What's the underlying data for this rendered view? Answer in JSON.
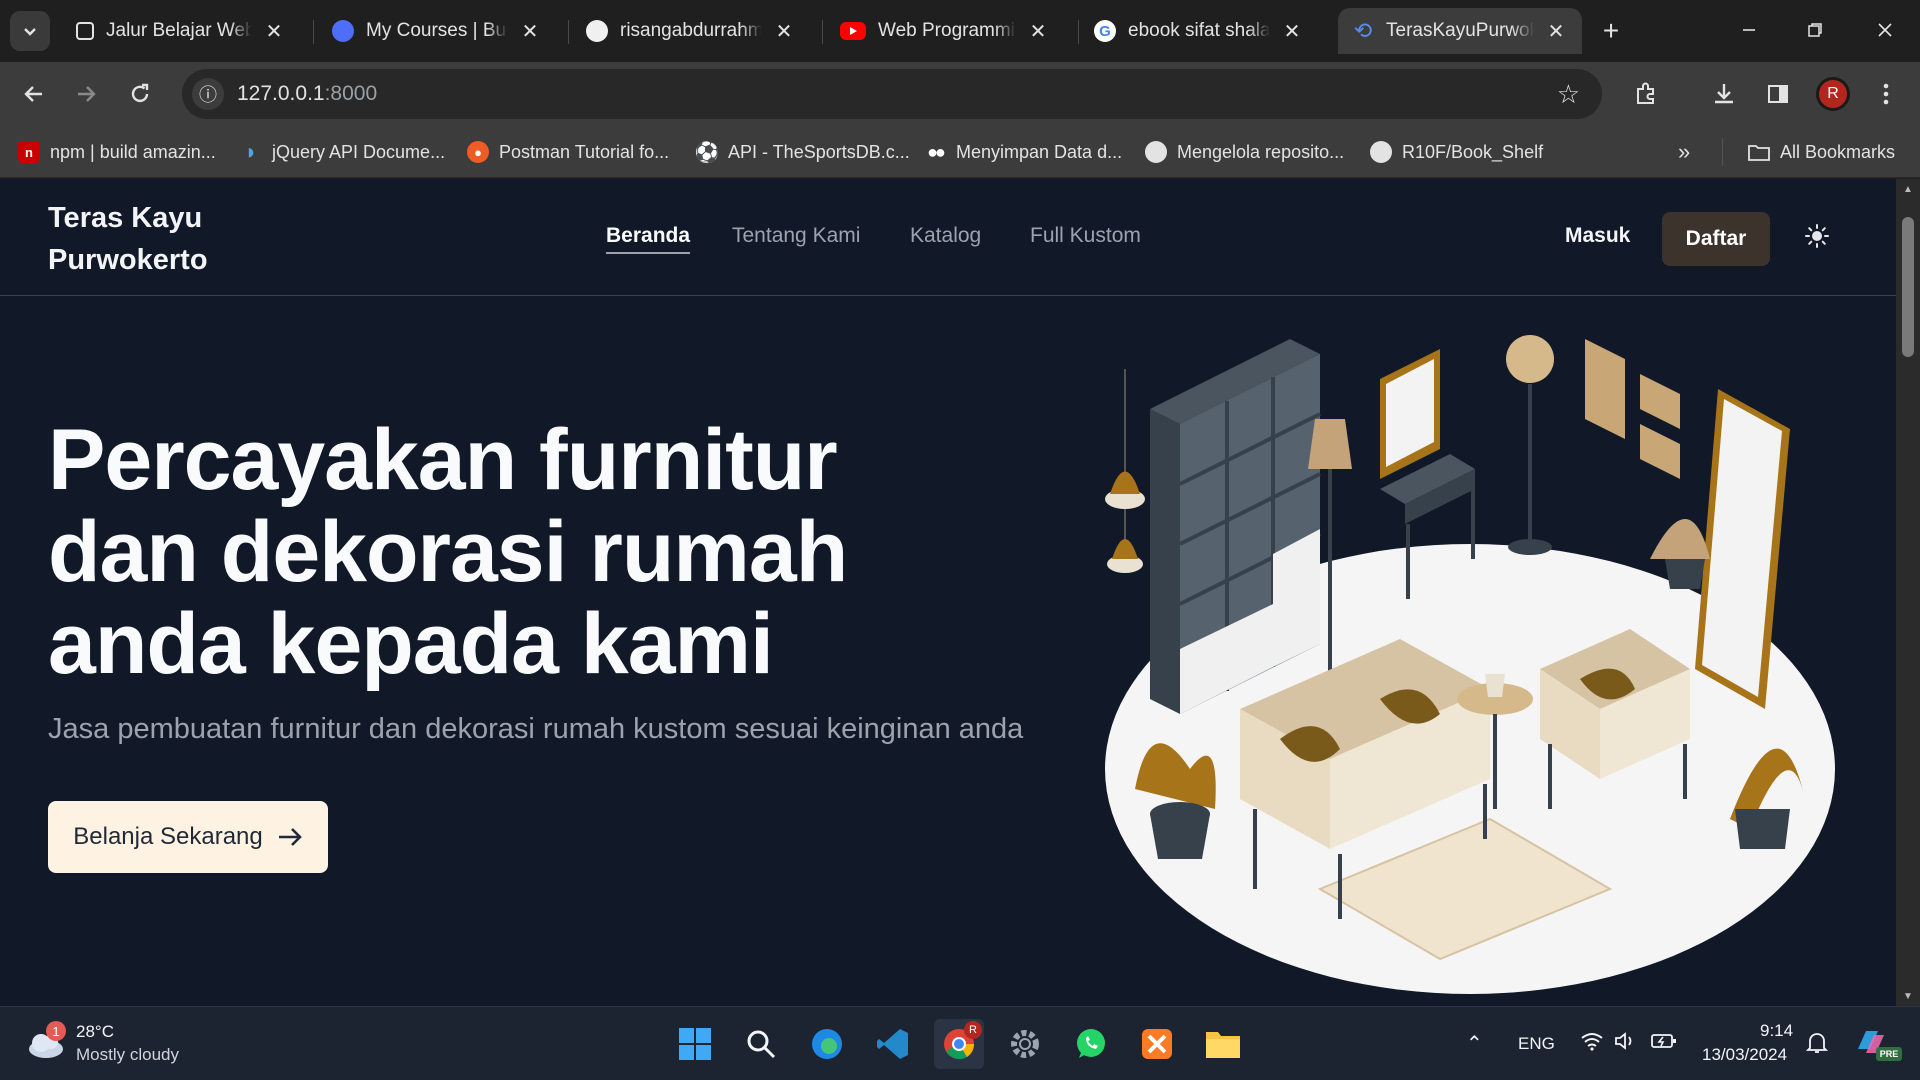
{
  "browser": {
    "tabs": [
      {
        "title": "Jalur Belajar Web Ver",
        "active": false
      },
      {
        "title": "My Courses | Build",
        "active": false
      },
      {
        "title": "risangabdurrahman",
        "active": false
      },
      {
        "title": "Web Programming",
        "active": false
      },
      {
        "title": "ebook sifat shalat n",
        "active": false
      },
      {
        "title": "TerasKayuPurwoke",
        "active": true
      }
    ],
    "url_host": "127.0.0.1",
    "url_port": ":8000",
    "avatar_letter": "R",
    "bookmarks": [
      "npm | build amazin...",
      "jQuery API Docume...",
      "Postman Tutorial fo...",
      "API - TheSportsDB.c...",
      "Menyimpan Data d...",
      "Mengelola reposito...",
      "R10F/Book_Shelf"
    ],
    "all_bookmarks": "All Bookmarks"
  },
  "site": {
    "brand_line1": "Teras Kayu",
    "brand_line2": "Purwokerto",
    "nav": [
      "Beranda",
      "Tentang Kami",
      "Katalog",
      "Full Kustom"
    ],
    "login": "Masuk",
    "register": "Daftar",
    "hero_title": "Percayakan furnitur dan dekorasi rumah anda kepada kami",
    "hero_subtitle": "Jasa pembuatan furnitur dan dekorasi rumah kustom sesuai keinginan anda",
    "cta_label": "Belanja Sekarang"
  },
  "taskbar": {
    "weather_badge": "1",
    "temperature": "28°C",
    "weather": "Mostly cloudy",
    "language": "ENG",
    "time": "9:14",
    "date": "13/03/2024",
    "chrome_badge": "R",
    "copilot_badge": "PRE"
  },
  "colors": {
    "page_bg": "#111827",
    "cta_bg": "#fef3e2",
    "daftar_bg": "#3d332d"
  }
}
